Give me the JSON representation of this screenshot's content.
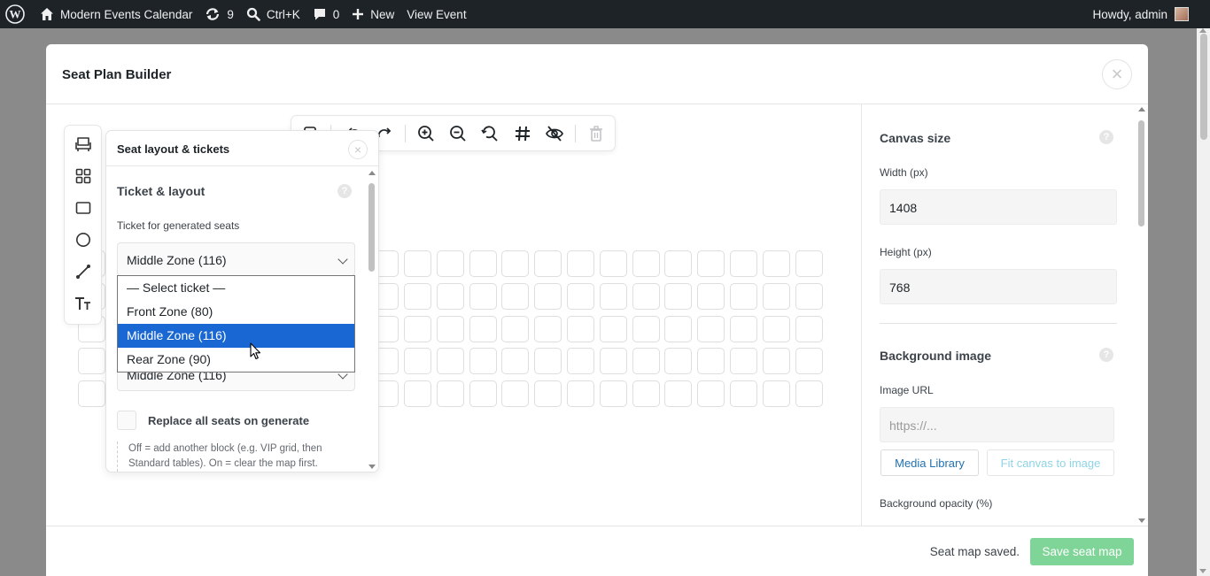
{
  "adminbar": {
    "site_name": "Modern Events Calendar",
    "updates_count": "9",
    "search_shortcut": "Ctrl+K",
    "comments_count": "0",
    "new_label": "New",
    "view_event_label": "View Event",
    "greeting": "Howdy, admin"
  },
  "modal": {
    "title": "Seat Plan Builder",
    "close_symbol": "×"
  },
  "toolbar": {
    "icons": [
      "seat-icon",
      "undo-icon",
      "redo-icon",
      "zoom-in-icon",
      "zoom-out-icon",
      "reset-zoom-icon",
      "grid-icon",
      "hide-icon",
      "trash-icon"
    ]
  },
  "rail": {
    "icons": [
      "seat-icon",
      "grid-block-icon",
      "rectangle-icon",
      "circle-icon",
      "line-icon",
      "text-icon"
    ]
  },
  "panel": {
    "title": "Seat layout & tickets",
    "close_symbol": "×",
    "section_title": "Ticket & layout",
    "help_symbol": "?",
    "ticket_label": "Ticket for generated seats",
    "ticket_value": "Middle Zone (116)",
    "second_select_value": "Middle Zone (116)",
    "replace_label": "Replace all seats on generate",
    "hint": "Off = add another block (e.g. VIP grid, then Standard tables). On = clear the map first."
  },
  "dropdown": {
    "options": [
      {
        "label": "— Select ticket —",
        "selected": false
      },
      {
        "label": "Front Zone (80)",
        "selected": false
      },
      {
        "label": "Middle Zone (116)",
        "selected": true
      },
      {
        "label": "Rear Zone (90)",
        "selected": false
      }
    ]
  },
  "settings": {
    "canvas_title": "Canvas size",
    "help_symbol": "?",
    "width_label": "Width (px)",
    "width_value": "1408",
    "height_label": "Height (px)",
    "height_value": "768",
    "bg_title": "Background image",
    "image_url_label": "Image URL",
    "image_url_placeholder": "https://...",
    "media_library_label": "Media Library",
    "fit_canvas_label": "Fit canvas to image",
    "opacity_label": "Background opacity (%)"
  },
  "footer": {
    "status": "Seat map saved.",
    "save_label": "Save seat map"
  },
  "seat_grid": {
    "rows": 5,
    "cols": 23
  },
  "colors": {
    "adminbar_bg": "#1d2327",
    "accent_blue": "#2271b1",
    "selected_option": "#1967d2",
    "save_button": "#7fd497",
    "link_teal": "#14a3c7"
  }
}
